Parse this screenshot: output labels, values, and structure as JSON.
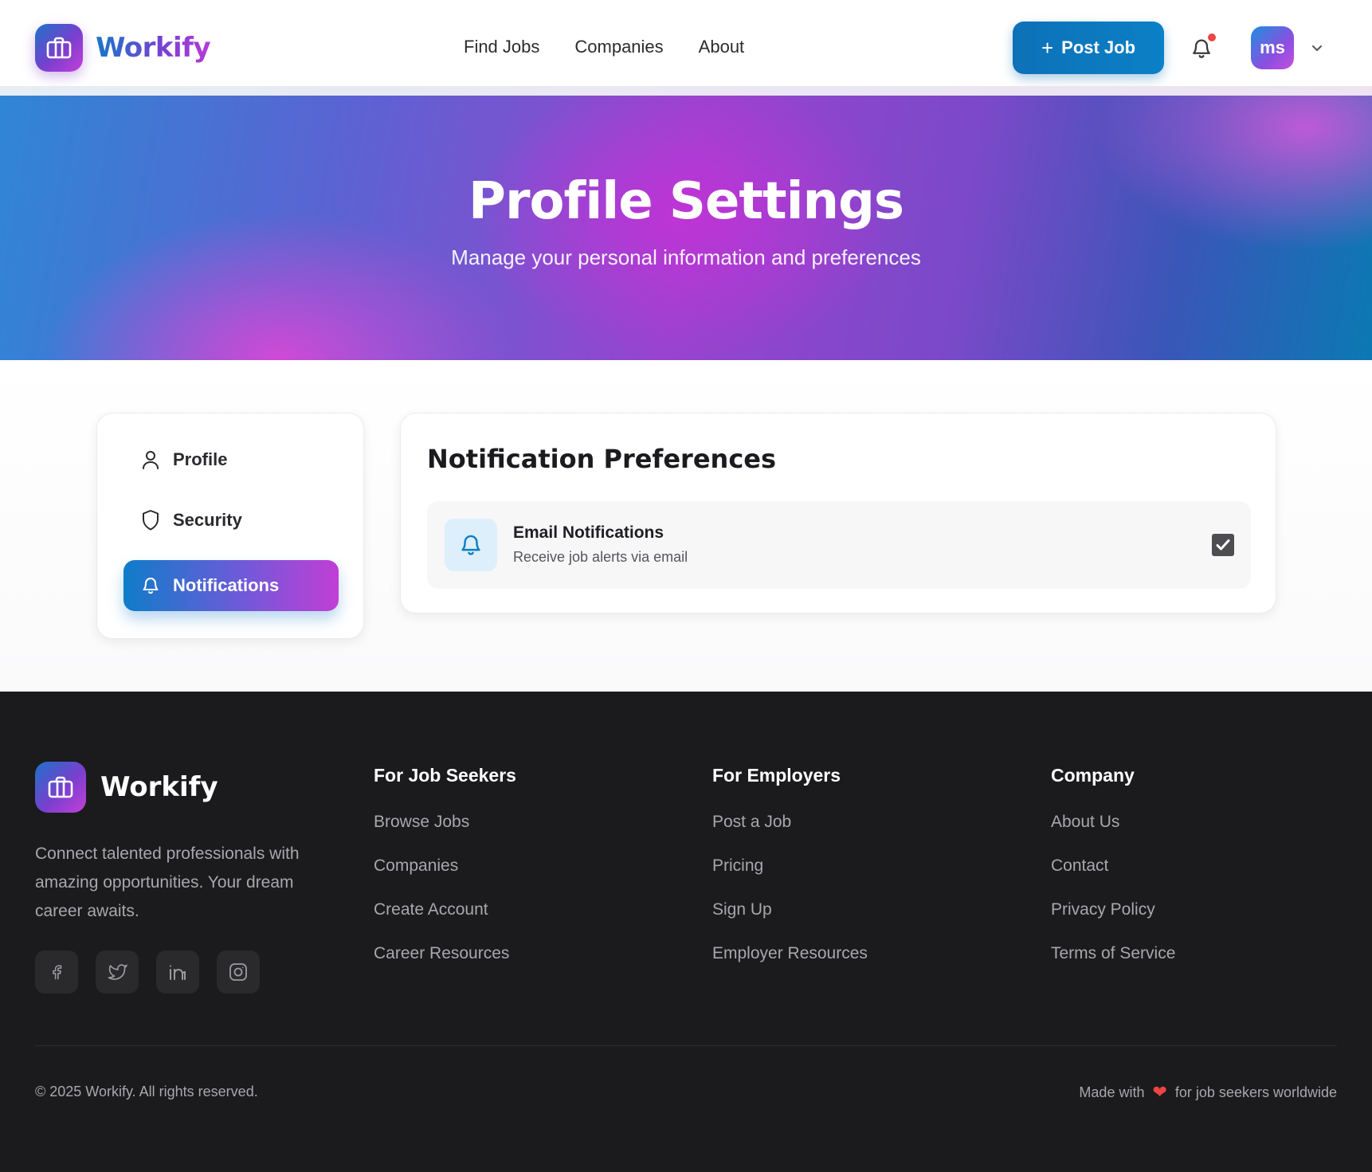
{
  "brand": {
    "name": "Workify"
  },
  "nav": {
    "items": [
      "Find Jobs",
      "Companies",
      "About"
    ]
  },
  "header": {
    "post_job_label": "Post Job",
    "avatar_initials": "ms"
  },
  "hero": {
    "title": "Profile Settings",
    "subtitle": "Manage your personal information and preferences"
  },
  "sidebar": {
    "items": [
      {
        "label": "Profile",
        "icon": "user-icon",
        "active": false
      },
      {
        "label": "Security",
        "icon": "shield-icon",
        "active": false
      },
      {
        "label": "Notifications",
        "icon": "bell-icon",
        "active": true
      }
    ]
  },
  "preferences": {
    "title": "Notification Preferences",
    "items": [
      {
        "label": "Email Notifications",
        "description": "Receive job alerts via email",
        "checked": true,
        "icon": "bell-icon"
      }
    ]
  },
  "footer": {
    "brand": "Workify",
    "description": "Connect talented professionals with amazing opportunities. Your dream career awaits.",
    "socials": [
      "facebook-icon",
      "twitter-icon",
      "linkedin-icon",
      "instagram-icon"
    ],
    "columns": [
      {
        "title": "For Job Seekers",
        "links": [
          "Browse Jobs",
          "Companies",
          "Create Account",
          "Career Resources"
        ]
      },
      {
        "title": "For Employers",
        "links": [
          "Post a Job",
          "Pricing",
          "Sign Up",
          "Employer Resources"
        ]
      },
      {
        "title": "Company",
        "links": [
          "About Us",
          "Contact",
          "Privacy Policy",
          "Terms of Service"
        ]
      }
    ],
    "copyright": "© 2025 Workify. All rights reserved.",
    "made_with_prefix": "Made with",
    "made_with_suffix": "for job seekers worldwide"
  },
  "colors": {
    "primary_blue": "#0d71b7",
    "accent_purple": "#c23ed6",
    "notification_dot": "#ef4444",
    "footer_bg": "#1b1b1d"
  }
}
